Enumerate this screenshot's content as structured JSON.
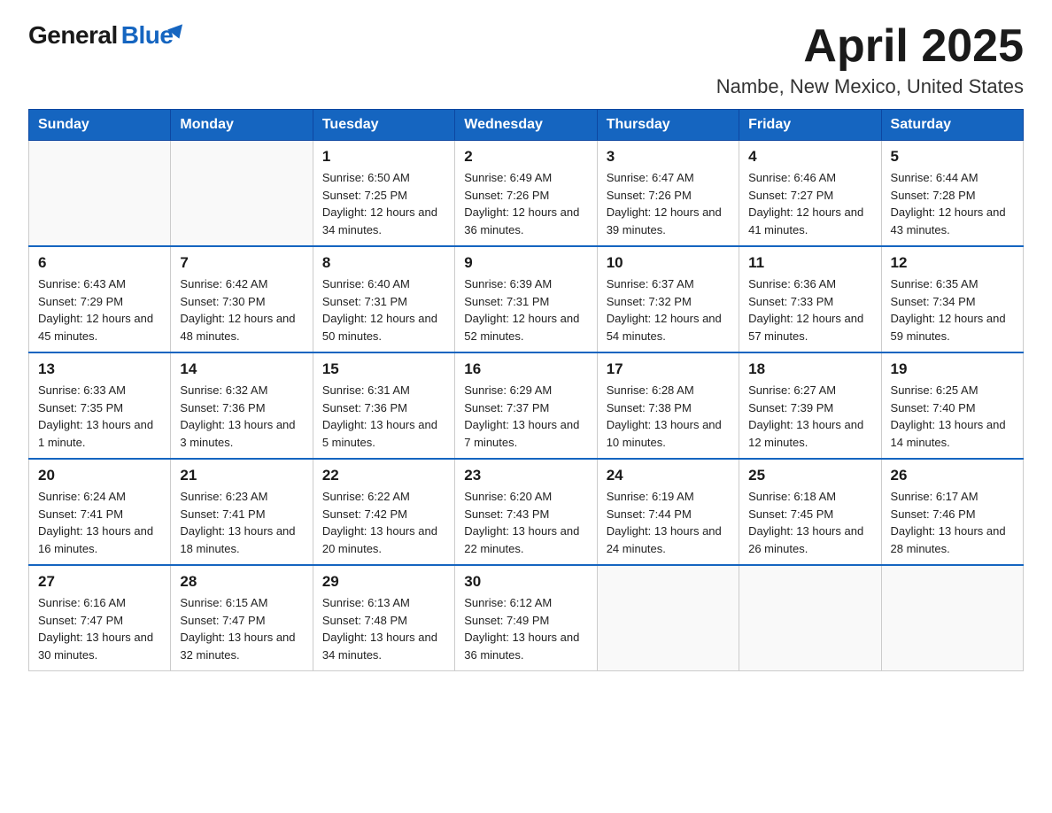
{
  "logo": {
    "general": "General",
    "blue": "Blue"
  },
  "title": "April 2025",
  "subtitle": "Nambe, New Mexico, United States",
  "days_of_week": [
    "Sunday",
    "Monday",
    "Tuesday",
    "Wednesday",
    "Thursday",
    "Friday",
    "Saturday"
  ],
  "weeks": [
    [
      {
        "day": "",
        "sunrise": "",
        "sunset": "",
        "daylight": ""
      },
      {
        "day": "",
        "sunrise": "",
        "sunset": "",
        "daylight": ""
      },
      {
        "day": "1",
        "sunrise": "Sunrise: 6:50 AM",
        "sunset": "Sunset: 7:25 PM",
        "daylight": "Daylight: 12 hours and 34 minutes."
      },
      {
        "day": "2",
        "sunrise": "Sunrise: 6:49 AM",
        "sunset": "Sunset: 7:26 PM",
        "daylight": "Daylight: 12 hours and 36 minutes."
      },
      {
        "day": "3",
        "sunrise": "Sunrise: 6:47 AM",
        "sunset": "Sunset: 7:26 PM",
        "daylight": "Daylight: 12 hours and 39 minutes."
      },
      {
        "day": "4",
        "sunrise": "Sunrise: 6:46 AM",
        "sunset": "Sunset: 7:27 PM",
        "daylight": "Daylight: 12 hours and 41 minutes."
      },
      {
        "day": "5",
        "sunrise": "Sunrise: 6:44 AM",
        "sunset": "Sunset: 7:28 PM",
        "daylight": "Daylight: 12 hours and 43 minutes."
      }
    ],
    [
      {
        "day": "6",
        "sunrise": "Sunrise: 6:43 AM",
        "sunset": "Sunset: 7:29 PM",
        "daylight": "Daylight: 12 hours and 45 minutes."
      },
      {
        "day": "7",
        "sunrise": "Sunrise: 6:42 AM",
        "sunset": "Sunset: 7:30 PM",
        "daylight": "Daylight: 12 hours and 48 minutes."
      },
      {
        "day": "8",
        "sunrise": "Sunrise: 6:40 AM",
        "sunset": "Sunset: 7:31 PM",
        "daylight": "Daylight: 12 hours and 50 minutes."
      },
      {
        "day": "9",
        "sunrise": "Sunrise: 6:39 AM",
        "sunset": "Sunset: 7:31 PM",
        "daylight": "Daylight: 12 hours and 52 minutes."
      },
      {
        "day": "10",
        "sunrise": "Sunrise: 6:37 AM",
        "sunset": "Sunset: 7:32 PM",
        "daylight": "Daylight: 12 hours and 54 minutes."
      },
      {
        "day": "11",
        "sunrise": "Sunrise: 6:36 AM",
        "sunset": "Sunset: 7:33 PM",
        "daylight": "Daylight: 12 hours and 57 minutes."
      },
      {
        "day": "12",
        "sunrise": "Sunrise: 6:35 AM",
        "sunset": "Sunset: 7:34 PM",
        "daylight": "Daylight: 12 hours and 59 minutes."
      }
    ],
    [
      {
        "day": "13",
        "sunrise": "Sunrise: 6:33 AM",
        "sunset": "Sunset: 7:35 PM",
        "daylight": "Daylight: 13 hours and 1 minute."
      },
      {
        "day": "14",
        "sunrise": "Sunrise: 6:32 AM",
        "sunset": "Sunset: 7:36 PM",
        "daylight": "Daylight: 13 hours and 3 minutes."
      },
      {
        "day": "15",
        "sunrise": "Sunrise: 6:31 AM",
        "sunset": "Sunset: 7:36 PM",
        "daylight": "Daylight: 13 hours and 5 minutes."
      },
      {
        "day": "16",
        "sunrise": "Sunrise: 6:29 AM",
        "sunset": "Sunset: 7:37 PM",
        "daylight": "Daylight: 13 hours and 7 minutes."
      },
      {
        "day": "17",
        "sunrise": "Sunrise: 6:28 AM",
        "sunset": "Sunset: 7:38 PM",
        "daylight": "Daylight: 13 hours and 10 minutes."
      },
      {
        "day": "18",
        "sunrise": "Sunrise: 6:27 AM",
        "sunset": "Sunset: 7:39 PM",
        "daylight": "Daylight: 13 hours and 12 minutes."
      },
      {
        "day": "19",
        "sunrise": "Sunrise: 6:25 AM",
        "sunset": "Sunset: 7:40 PM",
        "daylight": "Daylight: 13 hours and 14 minutes."
      }
    ],
    [
      {
        "day": "20",
        "sunrise": "Sunrise: 6:24 AM",
        "sunset": "Sunset: 7:41 PM",
        "daylight": "Daylight: 13 hours and 16 minutes."
      },
      {
        "day": "21",
        "sunrise": "Sunrise: 6:23 AM",
        "sunset": "Sunset: 7:41 PM",
        "daylight": "Daylight: 13 hours and 18 minutes."
      },
      {
        "day": "22",
        "sunrise": "Sunrise: 6:22 AM",
        "sunset": "Sunset: 7:42 PM",
        "daylight": "Daylight: 13 hours and 20 minutes."
      },
      {
        "day": "23",
        "sunrise": "Sunrise: 6:20 AM",
        "sunset": "Sunset: 7:43 PM",
        "daylight": "Daylight: 13 hours and 22 minutes."
      },
      {
        "day": "24",
        "sunrise": "Sunrise: 6:19 AM",
        "sunset": "Sunset: 7:44 PM",
        "daylight": "Daylight: 13 hours and 24 minutes."
      },
      {
        "day": "25",
        "sunrise": "Sunrise: 6:18 AM",
        "sunset": "Sunset: 7:45 PM",
        "daylight": "Daylight: 13 hours and 26 minutes."
      },
      {
        "day": "26",
        "sunrise": "Sunrise: 6:17 AM",
        "sunset": "Sunset: 7:46 PM",
        "daylight": "Daylight: 13 hours and 28 minutes."
      }
    ],
    [
      {
        "day": "27",
        "sunrise": "Sunrise: 6:16 AM",
        "sunset": "Sunset: 7:47 PM",
        "daylight": "Daylight: 13 hours and 30 minutes."
      },
      {
        "day": "28",
        "sunrise": "Sunrise: 6:15 AM",
        "sunset": "Sunset: 7:47 PM",
        "daylight": "Daylight: 13 hours and 32 minutes."
      },
      {
        "day": "29",
        "sunrise": "Sunrise: 6:13 AM",
        "sunset": "Sunset: 7:48 PM",
        "daylight": "Daylight: 13 hours and 34 minutes."
      },
      {
        "day": "30",
        "sunrise": "Sunrise: 6:12 AM",
        "sunset": "Sunset: 7:49 PM",
        "daylight": "Daylight: 13 hours and 36 minutes."
      },
      {
        "day": "",
        "sunrise": "",
        "sunset": "",
        "daylight": ""
      },
      {
        "day": "",
        "sunrise": "",
        "sunset": "",
        "daylight": ""
      },
      {
        "day": "",
        "sunrise": "",
        "sunset": "",
        "daylight": ""
      }
    ]
  ]
}
